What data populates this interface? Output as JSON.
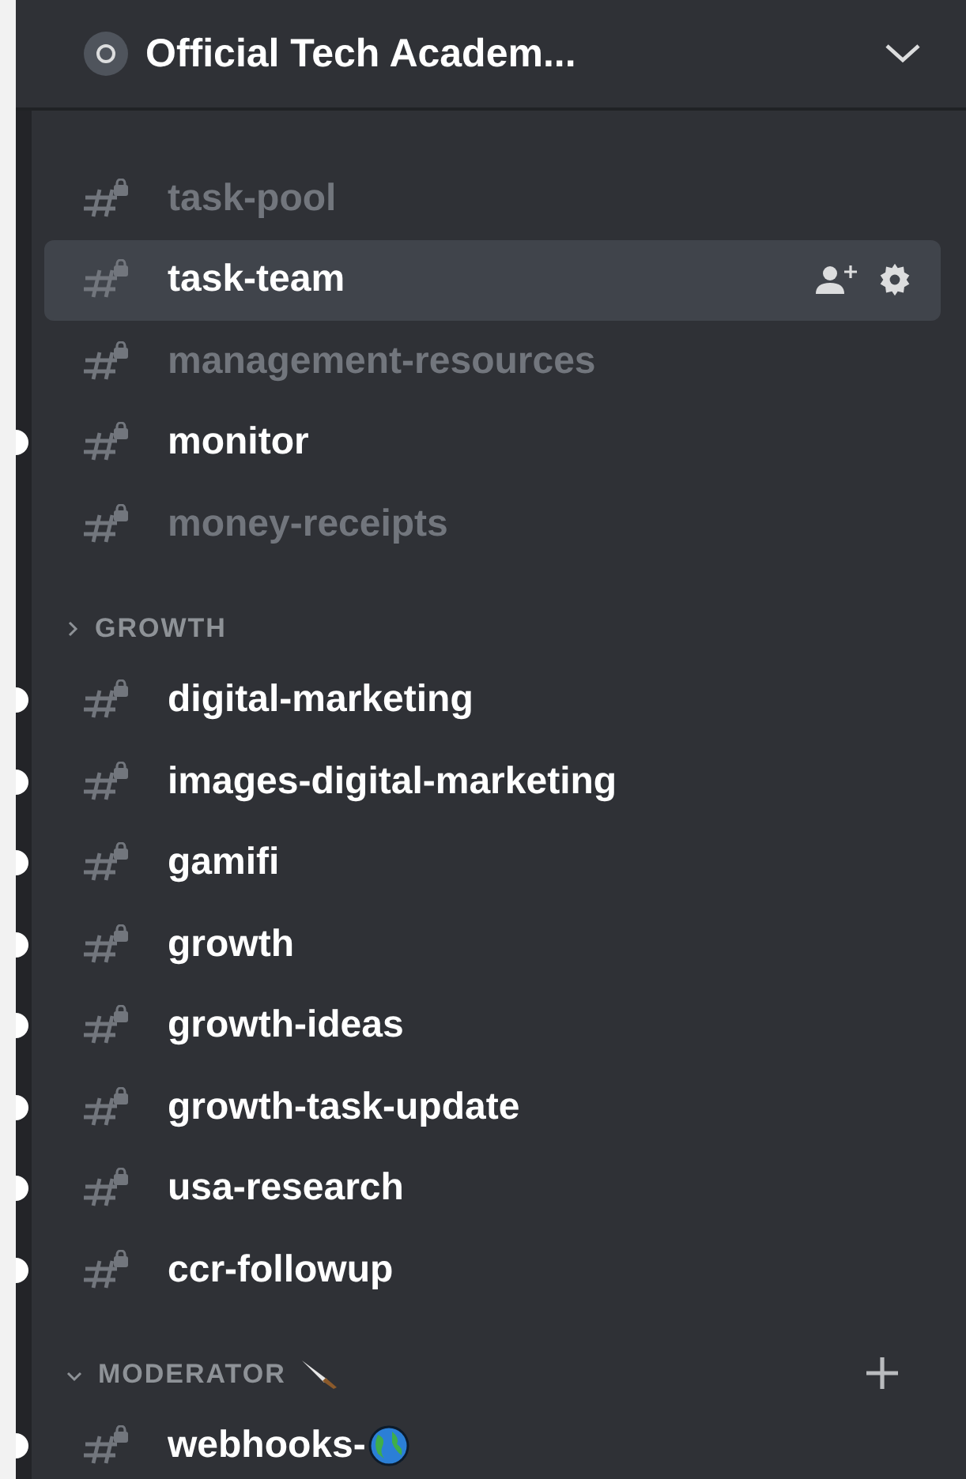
{
  "server": {
    "name": "Official Tech Academ..."
  },
  "sections": [
    {
      "channels": [
        {
          "name": "task-pool",
          "unread": false,
          "selected": false
        },
        {
          "name": "task-team",
          "unread": false,
          "selected": true
        },
        {
          "name": "management-resources",
          "unread": false,
          "selected": false
        },
        {
          "name": "monitor",
          "unread": true,
          "selected": false
        },
        {
          "name": "money-receipts",
          "unread": false,
          "selected": false
        }
      ]
    },
    {
      "category": {
        "name": "GROWTH",
        "expanded": false
      },
      "channels": [
        {
          "name": "digital-marketing",
          "unread": true,
          "selected": false
        },
        {
          "name": "images-digital-marketing",
          "unread": true,
          "selected": false
        },
        {
          "name": "gamifi",
          "unread": true,
          "selected": false
        },
        {
          "name": "growth",
          "unread": true,
          "selected": false
        },
        {
          "name": "growth-ideas",
          "unread": true,
          "selected": false
        },
        {
          "name": "growth-task-update",
          "unread": true,
          "selected": false
        },
        {
          "name": "usa-research",
          "unread": true,
          "selected": false
        },
        {
          "name": "ccr-followup",
          "unread": true,
          "selected": false
        }
      ]
    },
    {
      "category": {
        "name": "MODERATOR",
        "expanded": true,
        "add_button": true,
        "knife_icon": true
      },
      "channels": [
        {
          "name": "webhooks-",
          "unread": true,
          "selected": false,
          "globe_icon": true
        }
      ]
    }
  ]
}
